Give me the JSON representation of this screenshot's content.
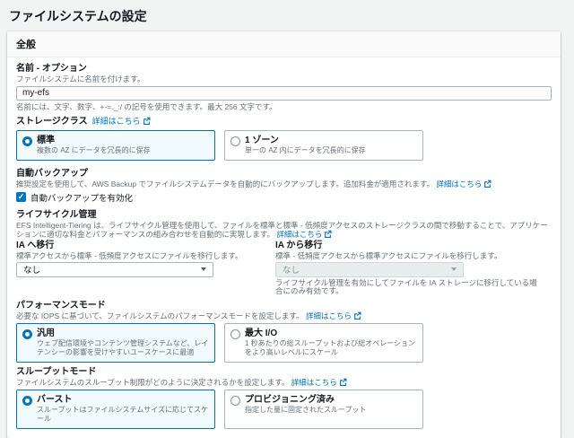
{
  "page": {
    "title": "ファイルシステムの設定"
  },
  "panel": {
    "header": "全般"
  },
  "colors": {
    "accent": "#0073bb",
    "selected_card_bg": "#f0faff",
    "page_bg": "#f2f3f3",
    "secondary_text": "#687078"
  },
  "name_section": {
    "label": "名前 - オプション",
    "desc": "ファイルシステムに名前を付けます。",
    "value": "my-efs",
    "hint": "名前には、文字、数字、+-=._:/ の記号を使用できます。最大 256 文字です。"
  },
  "storage_class": {
    "label": "ストレージクラス",
    "link": "詳細はこちら",
    "options": [
      {
        "label": "標準",
        "desc": "複数の AZ にデータを冗長的に保存",
        "selected": true
      },
      {
        "label": "1 ゾーン",
        "desc": "単一の AZ 内にデータを冗長的に保存",
        "selected": false
      }
    ]
  },
  "backup": {
    "label": "自動バックアップ",
    "desc": "推奨設定を使用して、AWS Backup でファイルシステムデータを自動的にバックアップします。追加料金が適用されます。",
    "link": "詳細はこちら",
    "checkbox_label": "自動バックアップを有効化",
    "checked": true
  },
  "lifecycle": {
    "label": "ライフサイクル管理",
    "desc": "EFS Intelligent-Tiering は、ライフサイクル管理を使用して、ファイルを標準と標準 - 低頻度アクセスのストレージクラスの間で移動することで、アプリケーションに適切な料金とパフォーマンスの組み合わせを自動的に実現します。",
    "link": "詳細はこちら",
    "into_ia": {
      "label": "IA へ移行",
      "desc": "標準アクセスから標準 - 低頻度アクセスにファイルを移行します。",
      "value": "なし"
    },
    "out_of_ia": {
      "label": "IA から移行",
      "desc": "標準 - 低頻度アクセスから標準アクセスにファイルを移行します。",
      "value": "なし",
      "note": "ライフサイクル管理を有効にしてファイルを IA ストレージに移行している場合にのみ有効です。"
    }
  },
  "performance": {
    "label": "パフォーマンスモード",
    "desc": "必要な IOPS に基づいて、ファイルシステムのパフォーマンスモードを設定します。",
    "link": "詳細はこちら",
    "options": [
      {
        "label": "汎用",
        "desc": "ウェブ配信環境やコンテンツ管理システムなど、レイテンシーの影響を受けやすいユースケースに最適",
        "selected": true
      },
      {
        "label": "最大 I/O",
        "desc": "1 秒あたりの総スループットおよび総オペレーションをより高いレベルにスケール",
        "selected": false
      }
    ]
  },
  "throughput": {
    "label": "スループットモード",
    "desc": "ファイルシステムのスループット制限がどのように決定されるかを設定します。",
    "link": "詳細はこちら",
    "options": [
      {
        "label": "バースト",
        "desc": "スループットはファイルシステムサイズに応じてスケール",
        "selected": true
      },
      {
        "label": "プロビジョニング済み",
        "desc": "指定した量に固定されたスループット",
        "selected": false
      }
    ]
  },
  "check_glyph": "✓"
}
